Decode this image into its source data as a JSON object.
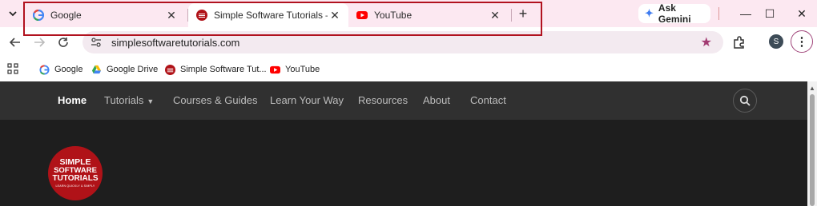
{
  "tabs": [
    {
      "title": "Google",
      "close": "✕"
    },
    {
      "title": "Simple Software Tutorials – Lea",
      "close": "✕"
    },
    {
      "title": "YouTube",
      "close": "✕"
    }
  ],
  "new_tab": "+",
  "gemini_label": "Ask Gemini",
  "window_controls": {
    "minimize": "—",
    "maximize": "☐",
    "close": "✕"
  },
  "url": "simplesoftwaretutorials.com",
  "profile_initial": "S",
  "menu_glyph": "⋮",
  "bookmarks": [
    {
      "label": "Google",
      "icon": "google-icon"
    },
    {
      "label": "Google Drive",
      "icon": "google-drive-icon"
    },
    {
      "label": "Simple Software Tut...",
      "icon": "sst-icon"
    },
    {
      "label": "YouTube",
      "icon": "youtube-icon"
    }
  ],
  "site_nav": {
    "items": [
      "Home",
      "Tutorials",
      "Courses & Guides",
      "Learn Your Way",
      "Resources",
      "About",
      "Contact"
    ],
    "caret": "▼"
  },
  "logo": {
    "line1": "SIMPLE",
    "line2": "SOFTWARE",
    "line3": "TUTORIALS",
    "tagline": "LEARN QUICKLY & SIMPLY"
  },
  "colors": {
    "chrome_bg": "#fce8f1",
    "highlight_box": "#b1121f",
    "site_nav_bg": "#303030",
    "site_bg": "#1e1e1e",
    "logo_red": "#b01218",
    "bookmark_star": "#a23b72"
  }
}
